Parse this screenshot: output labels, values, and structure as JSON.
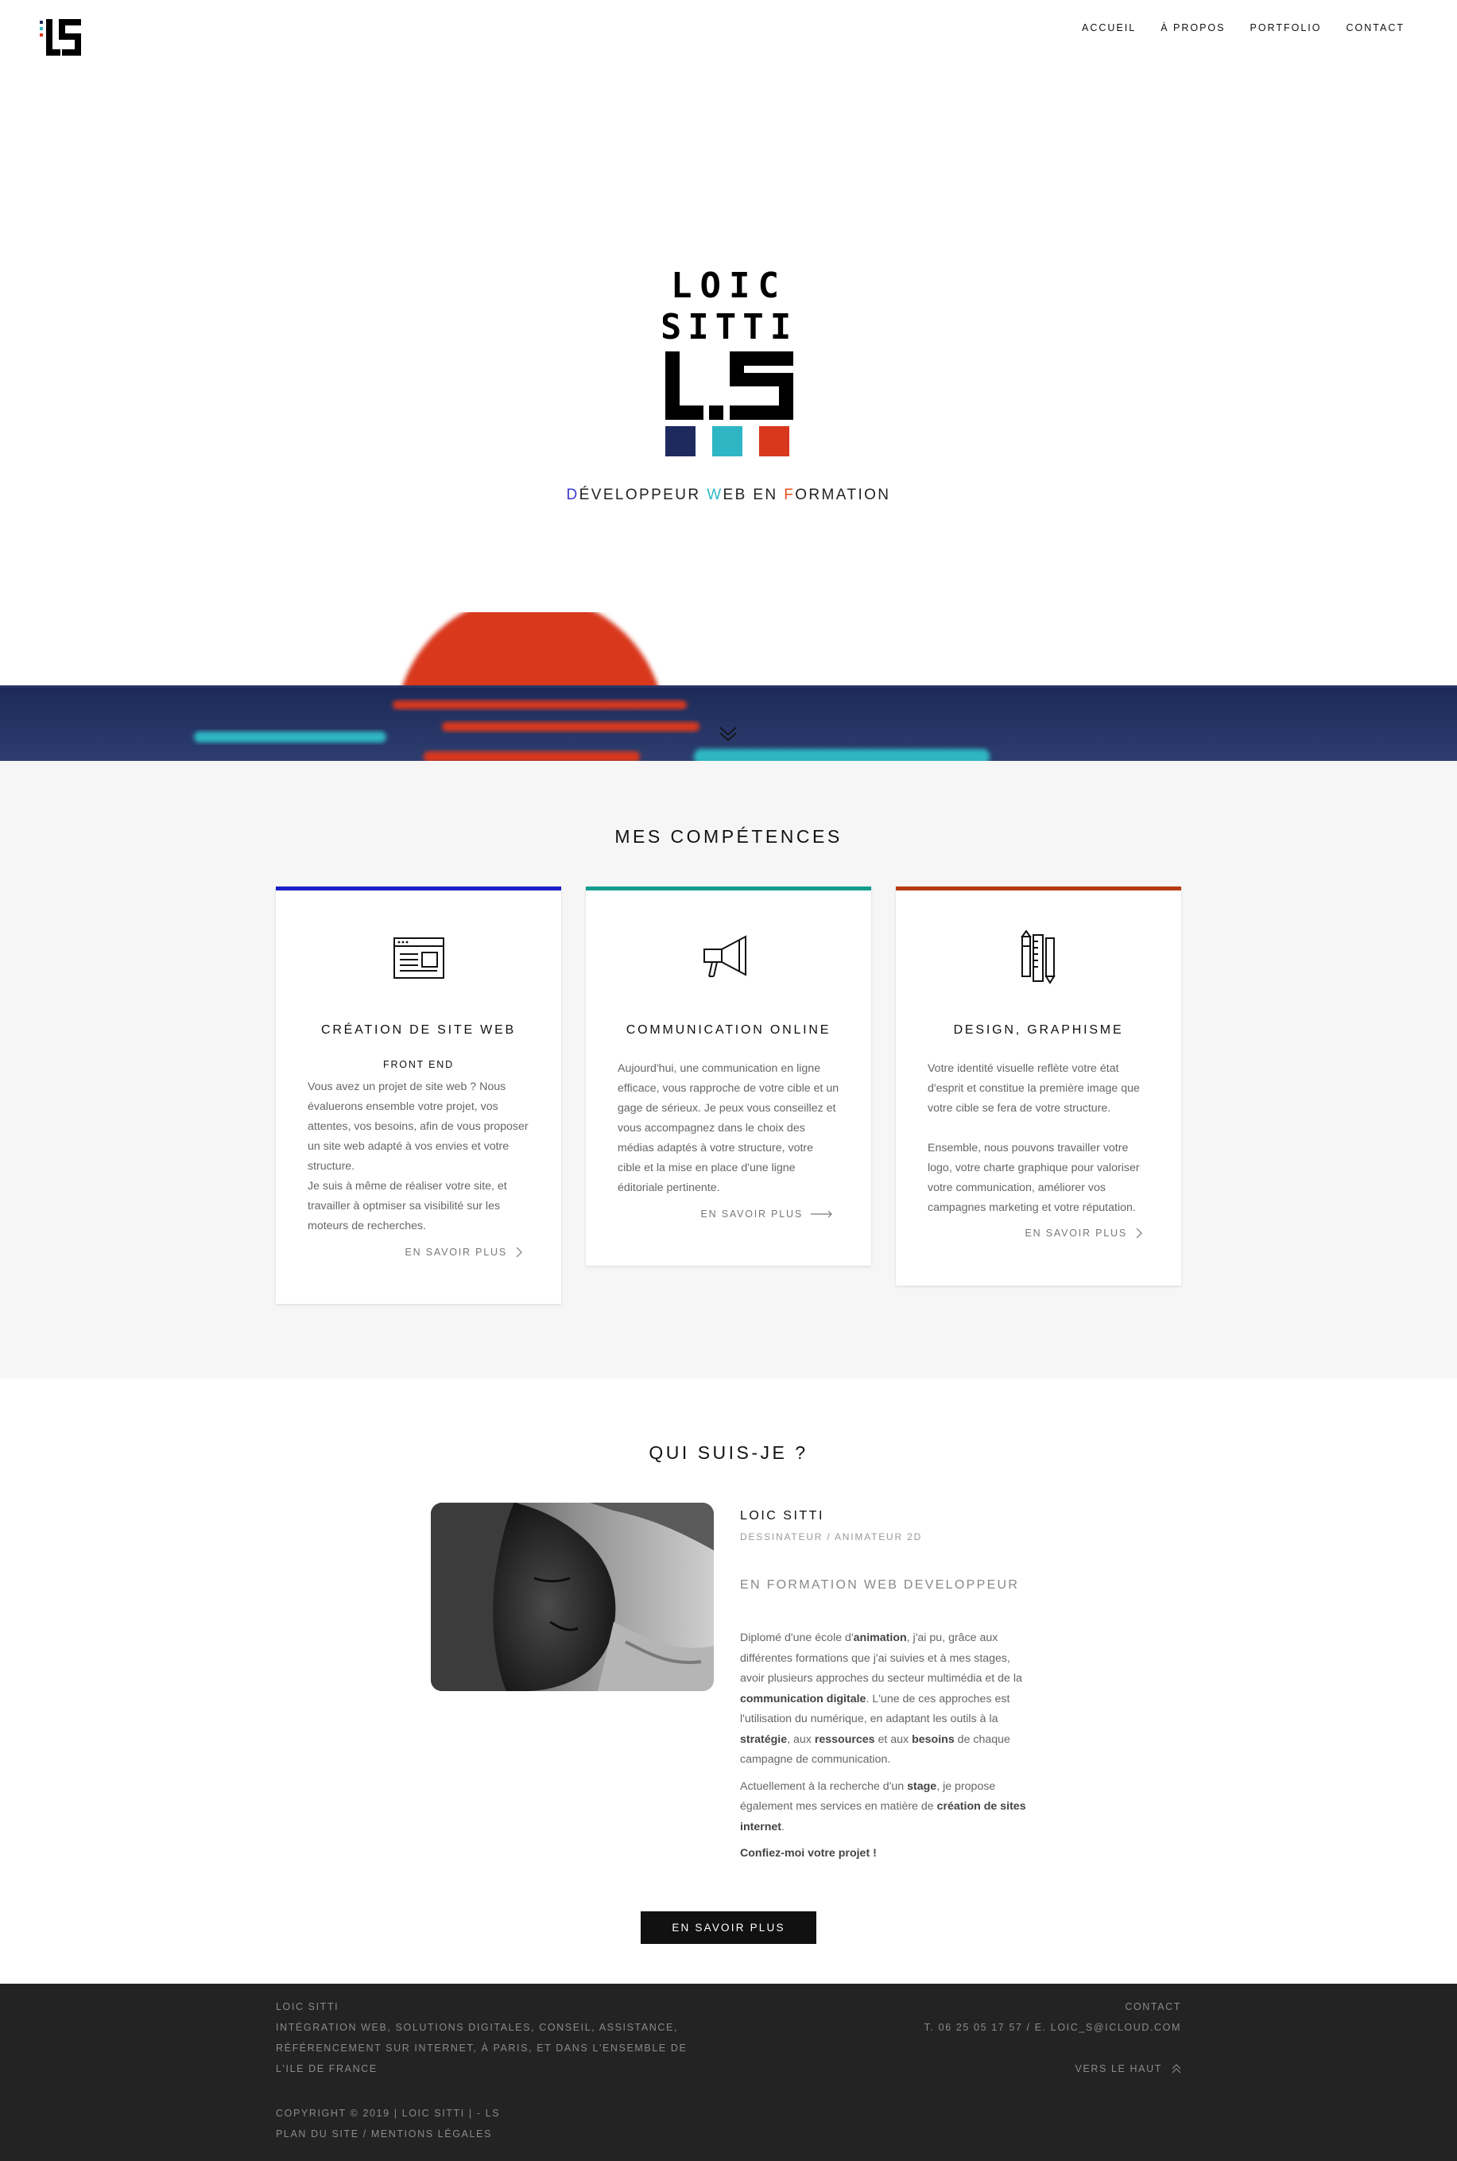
{
  "nav": {
    "items": [
      "ACCUEIL",
      "À PROPOS",
      "PORTFOLIO",
      "CONTACT"
    ]
  },
  "hero": {
    "logo_text": {
      "line1": "LOIC",
      "line2": "SITTI",
      "mark": "L.S"
    },
    "tagline": {
      "d": "D",
      "p1": "ÉVELOPPEUR ",
      "w": "W",
      "p2": "EB EN ",
      "f": "F",
      "p3": "ORMATION"
    }
  },
  "colors": {
    "navy": "#1e2a5e",
    "cyan": "#2fb6c4",
    "orange": "#d9381e",
    "blue_border": "#1a1fc9",
    "teal_border": "#169c8f",
    "rust_border": "#b73a10",
    "footer_bg": "#232323"
  },
  "skills": {
    "title": "MES COMPÉTENCES",
    "cards": [
      {
        "icon": "browser-window-icon",
        "title": "CRÉATION DE SITE WEB",
        "subtitle": "FRONT END",
        "text": "Vous avez un projet de site web ? Nous évaluerons ensemble votre projet, vos attentes, vos besoins, afin de vous proposer un site web adapté à vos envies et votre structure.\nJe suis à même de réaliser votre site, et travailler à optmiser sa visibilité sur les moteurs de recherches.",
        "more": "EN SAVOIR PLUS"
      },
      {
        "icon": "megaphone-icon",
        "title": "COMMUNICATION ONLINE",
        "subtitle": "",
        "text": "Aujourd'hui, une communication en ligne efficace, vous rapproche de votre cible et un gage de sérieux. Je peux vous conseillez et vous accompagnez dans le choix des médias adaptés à votre structure, votre cible et la mise en place d'une ligne éditoriale pertinente.",
        "more": "EN SAVOIR PLUS"
      },
      {
        "icon": "design-tools-icon",
        "title": "DESIGN, GRAPHISME",
        "subtitle": "",
        "text": "Votre identité visuelle reflète votre état d'esprit et constitue la première image que votre cible se fera de votre structure.\n\nEnsemble, nous pouvons travailler votre logo, votre charte graphique pour valoriser votre communication, améliorer vos campagnes marketing et votre réputation.",
        "more": "EN SAVOIR PLUS"
      }
    ]
  },
  "about": {
    "title": "QUI SUIS-JE ?",
    "name": "LOIC SITTI",
    "role": "DESSINATEUR / ANIMATEUR 2D",
    "subtitle": "EN FORMATION WEB DEVELOPPEUR",
    "p1": {
      "a": "Diplomé d'une école d'",
      "b1": "animation",
      "c": ", j'ai pu, grâce aux différentes formations que j'ai suivies et à mes stages, avoir plusieurs approches du secteur multimédia et de la ",
      "b2": "communication digitale",
      "d": ". L'une de ces approches est l'utilisation du numérique, en adaptant les outils à la ",
      "b3": "stratégie",
      "e": ", aux ",
      "b4": "ressources",
      "f": " et aux ",
      "b5": "besoins",
      "g": " de chaque campagne de communication."
    },
    "p2": {
      "a": "Actuellement à la recherche d'un ",
      "b1": "stage",
      "c": ", je propose également mes services en matière de ",
      "b2": "création de sites internet",
      "d": "."
    },
    "p3": "Confiez-moi votre projet !",
    "button": "EN SAVOIR PLUS"
  },
  "footer": {
    "name": "LOIC SITTI",
    "description": "INTÉGRATION WEB, SOLUTIONS DIGITALES, CONSEIL, ASSISTANCE, RÉFÉRENCEMENT SUR INTERNET, À PARIS, ET DANS L'ENSEMBLE DE L'ILE DE FRANCE",
    "copyright": "COPYRIGHT © 2019 | LOIC SITTI | - LS",
    "links": "PLAN DU SITE / MENTIONS LÉGALES",
    "contact_title": "CONTACT",
    "contact_info": "T. 06 25 05 17 57 / E. LOIC_S@ICLOUD.COM",
    "to_top": "VERS LE HAUT"
  }
}
